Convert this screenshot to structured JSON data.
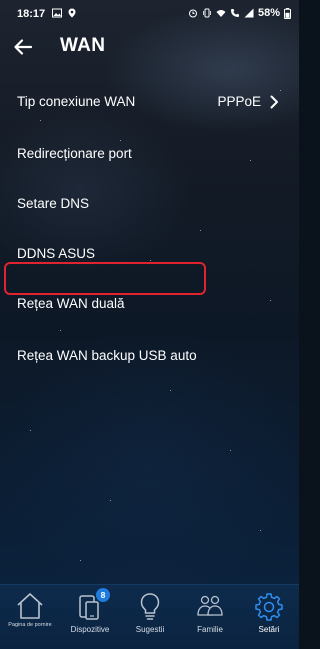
{
  "status_bar": {
    "time": "18:17",
    "battery": "58%",
    "left_icons": [
      "image-icon",
      "location-icon"
    ],
    "right_icons": [
      "alarm-icon",
      "vibrate-icon",
      "wifi-icon",
      "call-icon",
      "signal-icon",
      "battery-icon"
    ]
  },
  "header": {
    "title": "WAN",
    "back_icon": "back-arrow-icon"
  },
  "menu": {
    "items": [
      {
        "label": "Tip conexiune WAN",
        "value": "PPPoE"
      },
      {
        "label": "Redirecționare port"
      },
      {
        "label": "Setare DNS"
      },
      {
        "label": "DDNS ASUS"
      },
      {
        "label": "Rețea WAN duală"
      },
      {
        "label": "Rețea WAN backup USB auto"
      }
    ],
    "highlighted_item": "Rețea WAN backup USB auto",
    "highlight_color": "#e0232f"
  },
  "bottom_nav": {
    "items": [
      {
        "label": "Pagina de pornire",
        "icon": "home-icon"
      },
      {
        "label": "Dispozitive",
        "icon": "devices-icon",
        "badge": "8"
      },
      {
        "label": "Sugestii",
        "icon": "lightbulb-icon"
      },
      {
        "label": "Familie",
        "icon": "family-icon"
      },
      {
        "label": "Setări",
        "icon": "gear-icon",
        "active": true
      }
    ],
    "active_color": "#2f8ef0",
    "badge_color": "#1e7ce0"
  }
}
